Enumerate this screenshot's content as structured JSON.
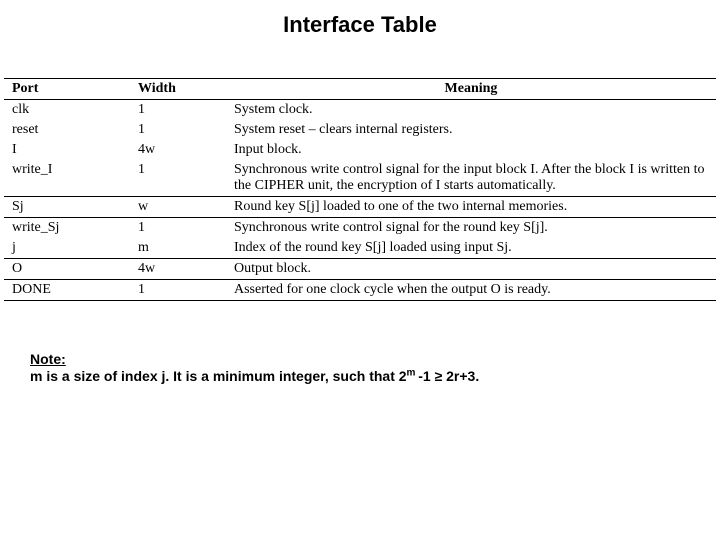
{
  "title": "Interface Table",
  "headers": {
    "port": "Port",
    "width": "Width",
    "meaning": "Meaning"
  },
  "rows": [
    {
      "port": "clk",
      "width": "1",
      "meaning": "System clock."
    },
    {
      "port": "reset",
      "width": "1",
      "meaning": "System reset – clears internal registers."
    },
    {
      "port": "I",
      "width": "4w",
      "meaning": "Input block."
    },
    {
      "port": "write_I",
      "width": "1",
      "meaning": "Synchronous write control signal for the input block I.  After the block I is written to the CIPHER unit, the encryption of I starts automatically."
    },
    {
      "port": "Sj",
      "width": "w",
      "meaning": "Round key S[j] loaded to one of the two internal memories."
    },
    {
      "port": "write_Sj",
      "width": "1",
      "meaning": "Synchronous write control signal for the round key S[j]."
    },
    {
      "port": "j",
      "width": "m",
      "meaning": "Index of the round key S[j] loaded using input Sj."
    },
    {
      "port": "O",
      "width": "4w",
      "meaning": "Output block."
    },
    {
      "port": "DONE",
      "width": "1",
      "meaning": "Asserted for one clock cycle when the output O is ready."
    }
  ],
  "note": {
    "label": "Note:",
    "text_prefix": "m is a size of index j. It is a minimum integer, such that 2",
    "sup1": "m ",
    "text_mid": "-1 ≥ 2r+3.",
    "full": "m is a size of index j. It is a minimum integer, such that 2^m -1 ≥ 2r+3."
  }
}
